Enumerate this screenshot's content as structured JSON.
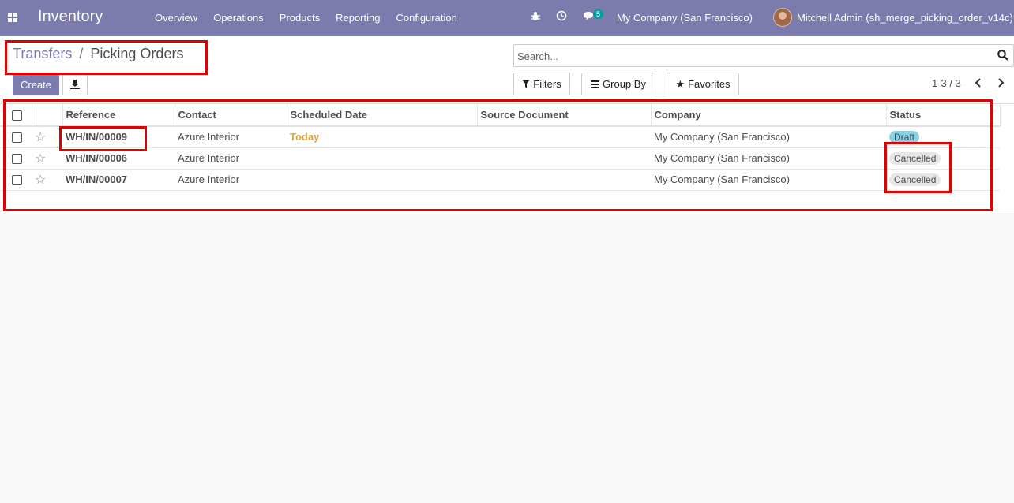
{
  "navbar": {
    "brand": "Inventory",
    "menu": [
      "Overview",
      "Operations",
      "Products",
      "Reporting",
      "Configuration"
    ],
    "chat_count": "5",
    "company": "My Company (San Francisco)",
    "user": "Mitchell Admin (sh_merge_picking_order_v14c)"
  },
  "breadcrumb": {
    "parent": "Transfers",
    "separator": "/",
    "current": "Picking Orders"
  },
  "actions": {
    "create": "Create"
  },
  "search": {
    "placeholder": "Search..."
  },
  "controls": {
    "filters": "Filters",
    "group_by": "Group By",
    "favorites": "Favorites"
  },
  "pager": {
    "range": "1-3 / 3"
  },
  "table": {
    "columns": [
      "Reference",
      "Contact",
      "Scheduled Date",
      "Source Document",
      "Company",
      "Status"
    ],
    "rows": [
      {
        "reference": "WH/IN/00009",
        "contact": "Azure Interior",
        "scheduled": "Today",
        "source": "",
        "company": "My Company (San Francisco)",
        "status": "Draft"
      },
      {
        "reference": "WH/IN/00006",
        "contact": "Azure Interior",
        "scheduled": "",
        "source": "",
        "company": "My Company (San Francisco)",
        "status": "Cancelled"
      },
      {
        "reference": "WH/IN/00007",
        "contact": "Azure Interior",
        "scheduled": "",
        "source": "",
        "company": "My Company (San Francisco)",
        "status": "Cancelled"
      }
    ]
  },
  "colors": {
    "navbar": "#7c7bad",
    "highlight": "#e00000",
    "today": "#e6a23c",
    "draft_badge": "#8ad0e0"
  }
}
